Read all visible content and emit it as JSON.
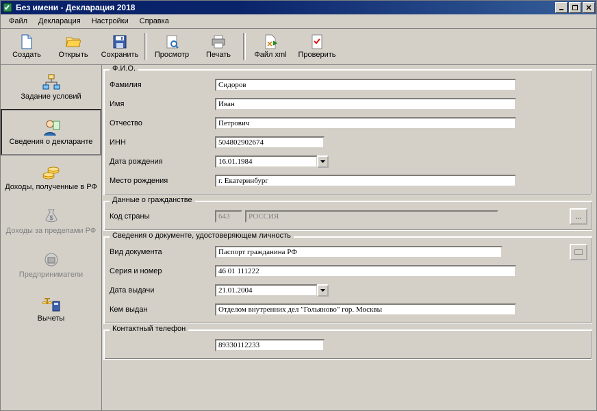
{
  "title": "Без имени - Декларация 2018",
  "menu": {
    "file": "Файл",
    "decl": "Декларация",
    "settings": "Настройки",
    "help": "Справка"
  },
  "toolbar": {
    "create": "Создать",
    "open": "Открыть",
    "save": "Сохранить",
    "preview": "Просмотр",
    "print": "Печать",
    "xml": "Файл xml",
    "check": "Проверить"
  },
  "sidebar": {
    "conditions": "Задание условий",
    "declarant": "Сведения о декларанте",
    "income_rf": "Доходы, полученные в РФ",
    "income_abroad": "Доходы за пределами РФ",
    "entrepreneurs": "Предприниматели",
    "deductions": "Вычеты"
  },
  "fio": {
    "title": "Ф.И.О.",
    "surname_label": "Фамилия",
    "surname": "Сидоров",
    "name_label": "Имя",
    "name": "Иван",
    "patronymic_label": "Отчество",
    "patronymic": "Петрович",
    "inn_label": "ИНН",
    "inn": "504802902674",
    "dob_label": "Дата рождения",
    "dob": "16.01.1984",
    "pob_label": "Место рождения",
    "pob": "г. Екатеринбург"
  },
  "citizenship": {
    "title": "Данные о гражданстве",
    "code_label": "Код страны",
    "code": "643",
    "country": "РОССИЯ",
    "btn": "..."
  },
  "iddoc": {
    "title": "Сведения о документе, удостоверяющем личность",
    "type_label": "Вид документа",
    "type": "Паспорт гражданина РФ",
    "series_label": "Серия и номер",
    "series": "46 01 111222",
    "issue_date_label": "Дата выдачи",
    "issue_date": "21.01.2004",
    "issued_by_label": "Кем выдан",
    "issued_by": "Отделом внутренних дел \"Гольяново\" гор. Москвы"
  },
  "phone": {
    "title": "Контактный телефон",
    "value": "89330112233"
  }
}
